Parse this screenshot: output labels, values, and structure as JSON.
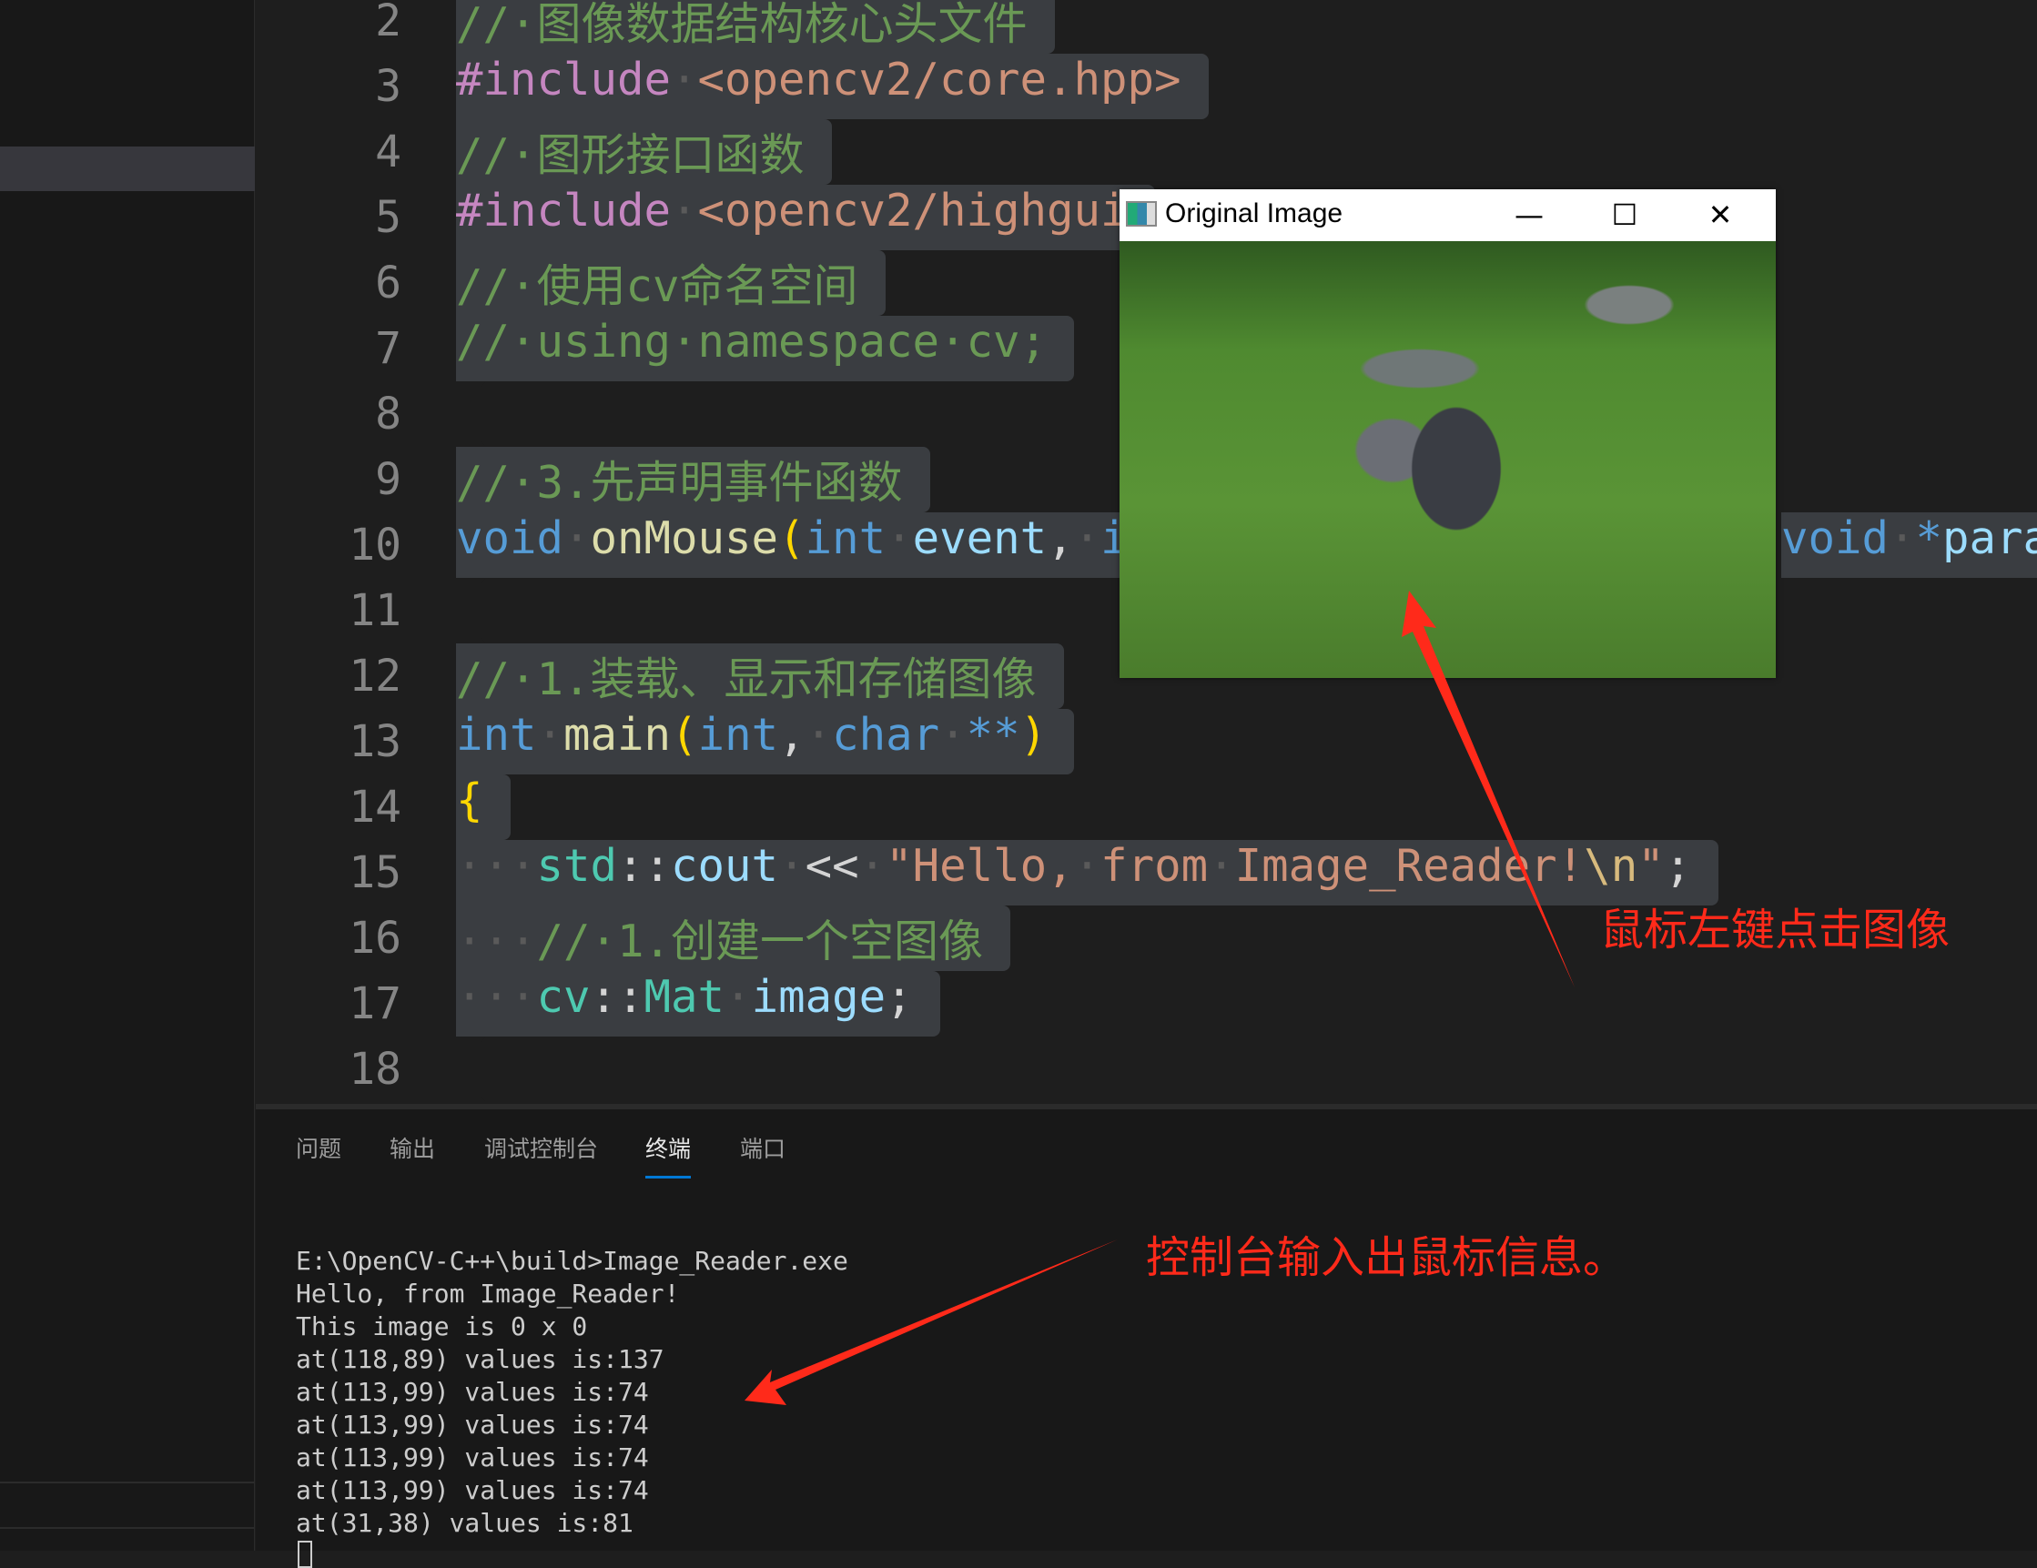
{
  "editor": {
    "lines": [
      {
        "n": "2",
        "tokens": [
          [
            "com",
            "//·图像数据结构核心头文件"
          ]
        ]
      },
      {
        "n": "3",
        "tokens": [
          [
            "inc",
            "#include"
          ],
          [
            "ws",
            "·"
          ],
          [
            "str",
            "<opencv2/core.hpp>"
          ]
        ]
      },
      {
        "n": "4",
        "tokens": [
          [
            "com",
            "//·图形接口函数"
          ]
        ]
      },
      {
        "n": "5",
        "tokens": [
          [
            "inc",
            "#include"
          ],
          [
            "ws",
            "·"
          ],
          [
            "str",
            "<opencv2/highgui"
          ]
        ]
      },
      {
        "n": "6",
        "tokens": [
          [
            "com",
            "//·使用cv命名空间"
          ]
        ]
      },
      {
        "n": "7",
        "tokens": [
          [
            "com",
            "//·using·namespace·cv;"
          ]
        ]
      },
      {
        "n": "8",
        "tokens": []
      },
      {
        "n": "9",
        "tokens": [
          [
            "com",
            "//·3.先声明事件函数"
          ]
        ]
      },
      {
        "n": "10",
        "tokens": [
          [
            "kw",
            "void"
          ],
          [
            "ws",
            "·"
          ],
          [
            "fn",
            "onMouse"
          ],
          [
            "br",
            "("
          ],
          [
            "kw",
            "int"
          ],
          [
            "ws",
            "·"
          ],
          [
            "var",
            "event"
          ],
          [
            "pl",
            ","
          ],
          [
            "ws",
            "·"
          ],
          [
            "kw",
            "i"
          ]
        ]
      },
      {
        "n": "11",
        "tokens": []
      },
      {
        "n": "12",
        "tokens": [
          [
            "com",
            "//·1.装载、显示和存储图像"
          ]
        ]
      },
      {
        "n": "13",
        "tokens": [
          [
            "kw",
            "int"
          ],
          [
            "ws",
            "·"
          ],
          [
            "fn",
            "main"
          ],
          [
            "br",
            "("
          ],
          [
            "kw",
            "int"
          ],
          [
            "pl",
            ","
          ],
          [
            "ws",
            "·"
          ],
          [
            "kw",
            "char"
          ],
          [
            "ws",
            "·"
          ],
          [
            "kw",
            "**"
          ],
          [
            "br",
            ")"
          ]
        ]
      },
      {
        "n": "14",
        "tokens": [
          [
            "br",
            "{"
          ]
        ]
      },
      {
        "n": "15",
        "tokens": [
          [
            "ws",
            "···"
          ],
          [
            "type",
            "std"
          ],
          [
            "pl",
            "::"
          ],
          [
            "var",
            "cout"
          ],
          [
            "ws",
            "·"
          ],
          [
            "pl",
            "<<"
          ],
          [
            "ws",
            "·"
          ],
          [
            "str",
            "\"Hello,"
          ],
          [
            "ws",
            "·"
          ],
          [
            "str",
            "from"
          ],
          [
            "ws",
            "·"
          ],
          [
            "str",
            "Image_Reader!"
          ],
          [
            "esc",
            "\\n"
          ],
          [
            "str",
            "\""
          ],
          [
            "pl",
            ";"
          ]
        ]
      },
      {
        "n": "16",
        "tokens": [
          [
            "ws",
            "···"
          ],
          [
            "com",
            "//·1.创建一个空图像"
          ]
        ]
      },
      {
        "n": "17",
        "tokens": [
          [
            "ws",
            "···"
          ],
          [
            "type",
            "cv"
          ],
          [
            "pl",
            "::"
          ],
          [
            "type",
            "Mat"
          ],
          [
            "ws",
            "·"
          ],
          [
            "var",
            "image"
          ],
          [
            "pl",
            ";"
          ]
        ]
      },
      {
        "n": "18",
        "tokens": []
      }
    ],
    "line10_right": [
      [
        "kw",
        "void"
      ],
      [
        "ws",
        "·"
      ],
      [
        "kw",
        "*"
      ],
      [
        "var",
        "para"
      ]
    ]
  },
  "window": {
    "title": "Original Image",
    "minimize": "—",
    "maximize": "☐",
    "close": "✕"
  },
  "panel": {
    "tabs": [
      {
        "label": "问题"
      },
      {
        "label": "输出"
      },
      {
        "label": "调试控制台"
      },
      {
        "label": "终端",
        "active": true
      },
      {
        "label": "端口"
      }
    ],
    "terminal": [
      "E:\\OpenCV-C++\\build>Image_Reader.exe",
      "Hello, from Image_Reader!",
      "This image is 0 x 0",
      "at(118,89) values is:137",
      "at(113,99) values is:74",
      "at(113,99) values is:74",
      "at(113,99) values is:74",
      "at(113,99) values is:74",
      "at(31,38) values is:81"
    ]
  },
  "annotations": {
    "click": "鼠标左键点击图像",
    "console": "控制台输入出鼠标信息。",
    "color": "#ff2a1a"
  }
}
